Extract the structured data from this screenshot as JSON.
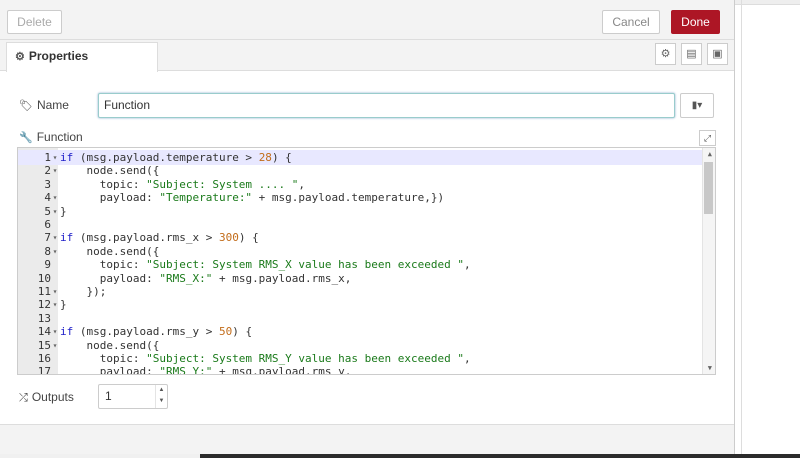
{
  "toolbar": {
    "delete_label": "Delete",
    "cancel_label": "Cancel",
    "done_label": "Done"
  },
  "tabs": {
    "properties_label": "Properties"
  },
  "form": {
    "name_label": "Name",
    "name_value": "Function",
    "function_label": "Function",
    "outputs_label": "Outputs",
    "outputs_value": "1"
  },
  "editor": {
    "lines": [
      {
        "n": "1",
        "fold": "▾",
        "code": "if (msg.payload.temperature > 28) {"
      },
      {
        "n": "2",
        "fold": "▾",
        "code": "    node.send({"
      },
      {
        "n": "3",
        "fold": "",
        "code": "      topic: \"Subject: System .... \","
      },
      {
        "n": "4",
        "fold": "▾",
        "code": "      payload: \"Temperature:\" + msg.payload.temperature,})"
      },
      {
        "n": "5",
        "fold": "▾",
        "code": "}"
      },
      {
        "n": "6",
        "fold": "",
        "code": ""
      },
      {
        "n": "7",
        "fold": "▾",
        "code": "if (msg.payload.rms_x > 300) {"
      },
      {
        "n": "8",
        "fold": "▾",
        "code": "    node.send({"
      },
      {
        "n": "9",
        "fold": "",
        "code": "      topic: \"Subject: System RMS_X value has been exceeded \","
      },
      {
        "n": "10",
        "fold": "",
        "code": "      payload: \"RMS_X:\" + msg.payload.rms_x,"
      },
      {
        "n": "11",
        "fold": "▾",
        "code": "    });"
      },
      {
        "n": "12",
        "fold": "▾",
        "code": "}"
      },
      {
        "n": "13",
        "fold": "",
        "code": ""
      },
      {
        "n": "14",
        "fold": "▾",
        "code": "if (msg.payload.rms_y > 50) {"
      },
      {
        "n": "15",
        "fold": "▾",
        "code": "    node.send({"
      },
      {
        "n": "16",
        "fold": "",
        "code": "      topic: \"Subject: System RMS_Y value has been exceeded \","
      },
      {
        "n": "17",
        "fold": "",
        "code": "      payload: \"RMS_Y:\" + msg.payload.rms_y,"
      }
    ]
  },
  "icons": {
    "gear": "gear-icon",
    "tag": "tag-icon",
    "wrench": "wrench-icon",
    "shuffle": "shuffle-icon"
  },
  "colors": {
    "done": "#ad1625",
    "keyword": "#1c1cc8",
    "string": "#1a7a1a",
    "number": "#c26c1a"
  }
}
